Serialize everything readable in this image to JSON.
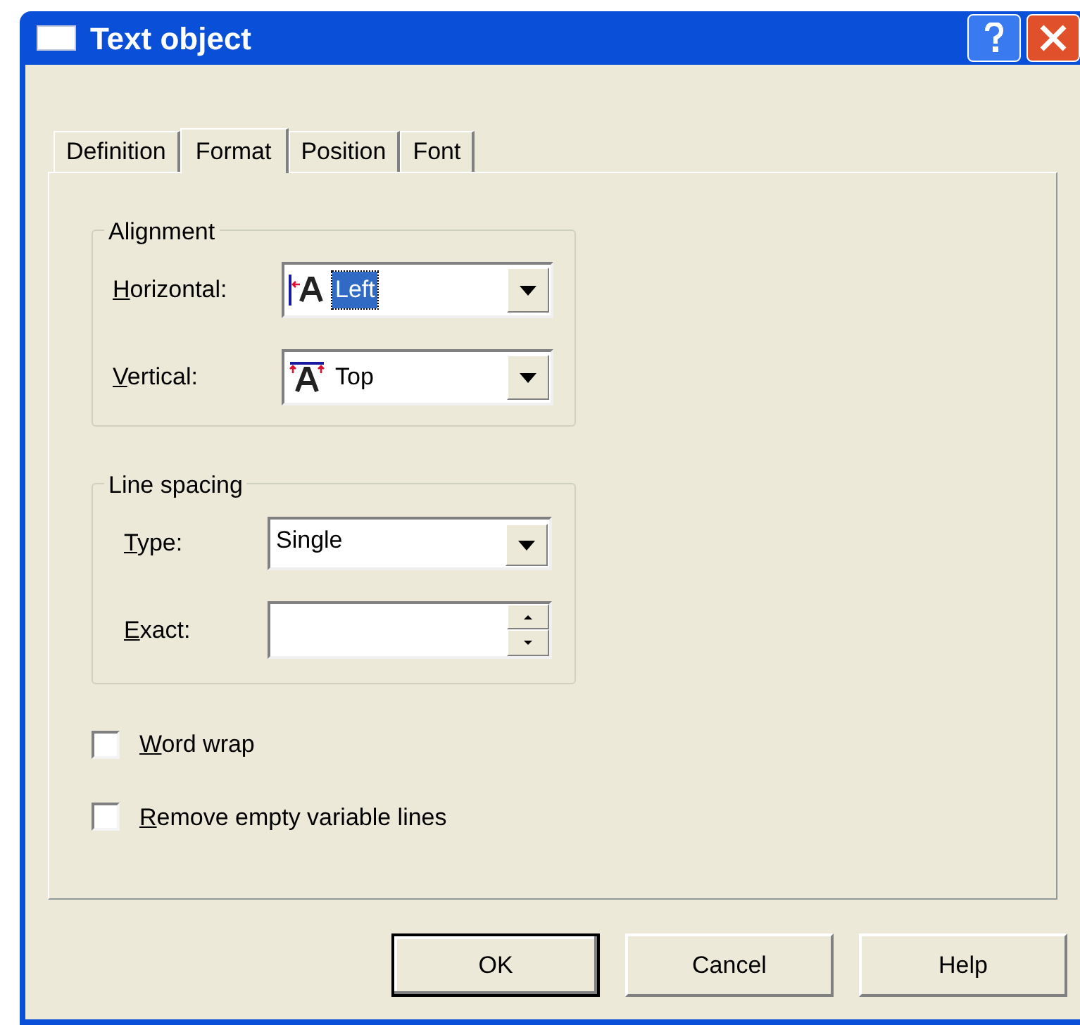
{
  "window": {
    "title": "Text object"
  },
  "tabs": [
    {
      "label": "Definition",
      "selected": false
    },
    {
      "label": "Format",
      "selected": true
    },
    {
      "label": "Position",
      "selected": false
    },
    {
      "label": "Font",
      "selected": false
    }
  ],
  "alignment": {
    "title": "Alignment",
    "fields": [
      {
        "label": "Horizontal:",
        "value": "Left",
        "kind": "left",
        "value_selected": true
      },
      {
        "label": "Vertical:",
        "value": "Top",
        "kind": "top",
        "value_selected": false
      }
    ]
  },
  "line_spacing": {
    "title": "Line spacing",
    "type": {
      "label": "Type:",
      "value": "Single"
    },
    "exact": {
      "label": "Exact:"
    }
  },
  "checkboxes": [
    {
      "label": "Word wrap",
      "checked": false
    },
    {
      "label": "Remove empty variable lines",
      "checked": false
    }
  ],
  "buttons": [
    {
      "label": "OK",
      "default": true
    },
    {
      "label": "Cancel",
      "default": false
    },
    {
      "label": "Help",
      "default": false
    }
  ]
}
